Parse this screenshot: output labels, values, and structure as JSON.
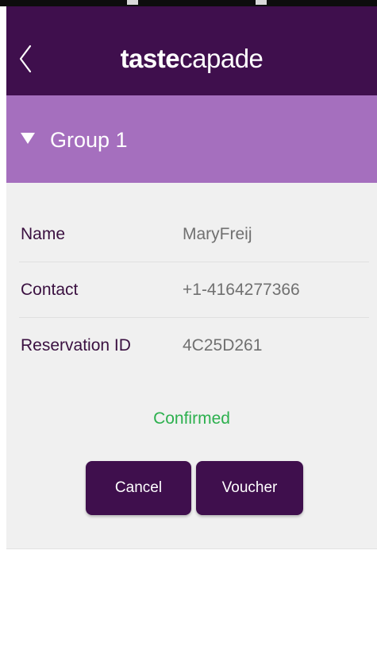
{
  "header": {
    "brand_strong": "taste",
    "brand_light": "capade",
    "back_icon": "chevron-left-icon"
  },
  "group": {
    "label": "Group 1",
    "toggle_icon": "triangle-down-icon",
    "expanded": true
  },
  "reservation": {
    "rows": [
      {
        "key": "Name",
        "value": "MaryFreij"
      },
      {
        "key": "Contact",
        "value": "+1-4164277366"
      },
      {
        "key": "Reservation ID",
        "value": "4C25D261"
      }
    ],
    "status": "Confirmed",
    "cancel_label": "Cancel",
    "voucher_label": "Voucher"
  },
  "colors": {
    "primary": "#3f0f4d",
    "group_header": "#a56fbe",
    "card_bg": "#f0f0f0",
    "status_confirmed": "#2cb04e"
  }
}
